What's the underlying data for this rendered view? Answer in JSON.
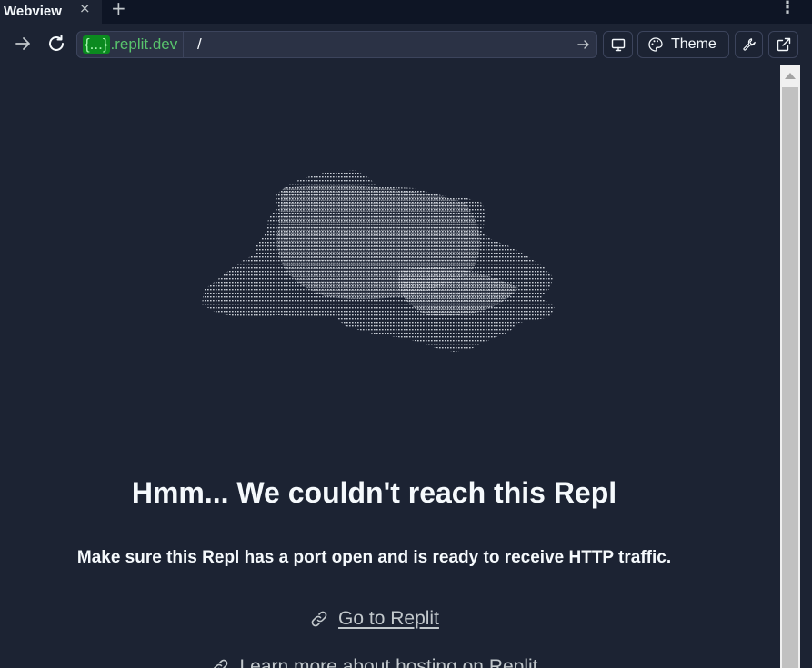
{
  "tabbar": {
    "tab_title": "Webview",
    "close_glyph": "×",
    "add_glyph": "+",
    "menu_glyph": "⋮"
  },
  "toolbar": {
    "url_brace": "{...}",
    "url_host": ".replit.dev",
    "url_path": "/",
    "theme_label": "Theme",
    "icons": [
      "forward-arrow-icon",
      "reload-icon",
      "go-arrow-icon",
      "monitor-icon",
      "palette-icon",
      "wrench-icon",
      "external-link-icon"
    ]
  },
  "main": {
    "heading": "Hmm... We couldn't reach this Repl",
    "subtext": "Make sure this Repl has a port open and is ready to receive HTTP traffic.",
    "link_go": "Go to Replit",
    "link_learn": "Learn more about hosting on Replit"
  },
  "colors": {
    "background": "#1c2333",
    "tabbar": "#0e1525",
    "url_green": "#58c46c",
    "text": "#f5f9fc",
    "muted": "#c2c8cc"
  }
}
